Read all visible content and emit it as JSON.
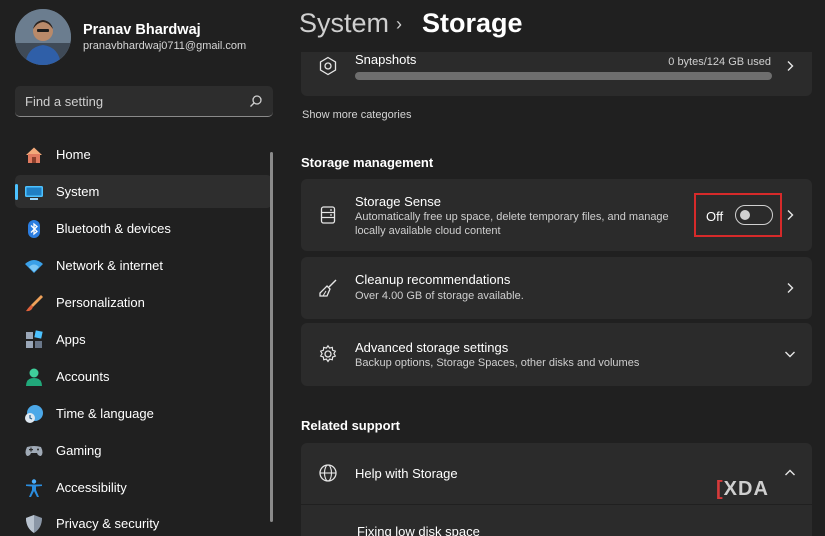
{
  "user": {
    "name": "Pranav Bhardwaj",
    "email": "pranavbhardwaj0711@gmail.com"
  },
  "search": {
    "placeholder": "Find a setting",
    "icon": "search-icon"
  },
  "nav": {
    "items": [
      {
        "label": "Home",
        "icon": "home-icon"
      },
      {
        "label": "System",
        "icon": "monitor-icon",
        "active": true
      },
      {
        "label": "Bluetooth & devices",
        "icon": "bluetooth-icon"
      },
      {
        "label": "Network & internet",
        "icon": "wifi-icon"
      },
      {
        "label": "Personalization",
        "icon": "paintbrush-icon"
      },
      {
        "label": "Apps",
        "icon": "apps-icon"
      },
      {
        "label": "Accounts",
        "icon": "person-icon"
      },
      {
        "label": "Time & language",
        "icon": "clock-globe-icon"
      },
      {
        "label": "Gaming",
        "icon": "gamepad-icon"
      },
      {
        "label": "Accessibility",
        "icon": "accessibility-icon"
      },
      {
        "label": "Privacy & security",
        "icon": "shield-icon"
      }
    ]
  },
  "breadcrumb": {
    "parent": "System",
    "separator": "›",
    "current": "Storage"
  },
  "snapshots": {
    "title": "Snapshots",
    "usage": "0 bytes/124 GB used",
    "fill_fraction": 0
  },
  "show_more": "Show more categories",
  "storage_management": {
    "heading": "Storage management",
    "storage_sense": {
      "title": "Storage Sense",
      "description_line1": "Automatically free up space, delete temporary files, and manage",
      "description_line2": "locally available cloud content",
      "toggle_label": "Off",
      "toggle_on": false
    },
    "cleanup": {
      "title": "Cleanup recommendations",
      "description": "Over 4.00 GB of storage available."
    },
    "advanced": {
      "title": "Advanced storage settings",
      "description": "Backup options, Storage Spaces, other disks and volumes"
    }
  },
  "related_support": {
    "heading": "Related support",
    "help": {
      "title": "Help with Storage",
      "link": "Fixing low disk space"
    }
  },
  "watermark": "XDA",
  "colors": {
    "background": "#202020",
    "card": "#2b2b2b",
    "accent": "#4cc2ff",
    "highlight": "#d62a2a"
  }
}
